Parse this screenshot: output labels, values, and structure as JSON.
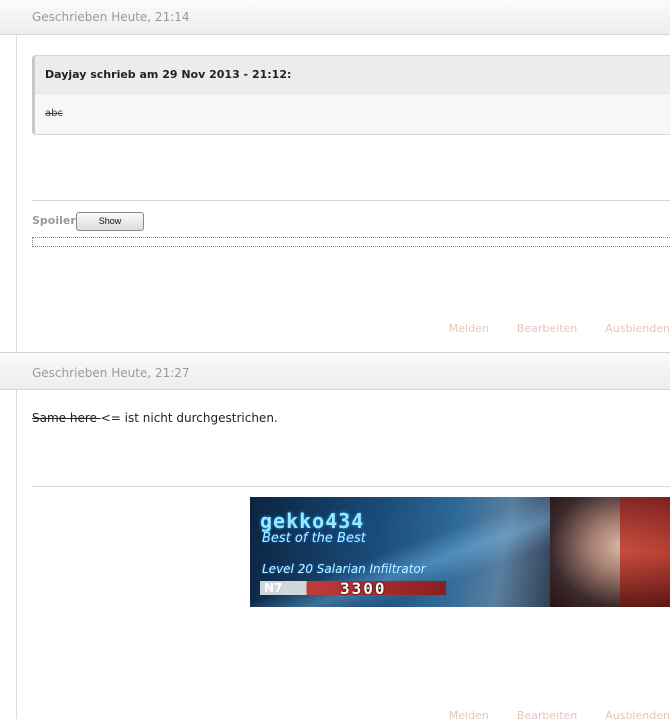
{
  "post1": {
    "date": "Geschrieben Heute, 21:14",
    "quote": {
      "citation": "Dayjay schrieb am 29 Nov 2013 - 21:12:",
      "body": "abc"
    },
    "spoiler": {
      "label": "Spoiler",
      "button": "Show"
    },
    "actions": [
      "Melden",
      "Bearbeiten",
      "Ausblenden"
    ]
  },
  "post2": {
    "date": "Geschrieben Heute, 21:27",
    "message": {
      "struck": "Same here ",
      "rest": " <= ist nicht durchgestrichen."
    },
    "signature": {
      "name": "gekko434",
      "title": "Best of the Best",
      "level": "Level 20 Salarian Infiltrator",
      "badge": "N7",
      "score": "3300"
    },
    "actions": [
      "Melden",
      "Bearbeiten",
      "Ausblenden"
    ]
  },
  "colors": {
    "header_bg": "#f0f0f0",
    "muted_text": "#9a9a9a",
    "action_text": "#e4c6bd"
  }
}
